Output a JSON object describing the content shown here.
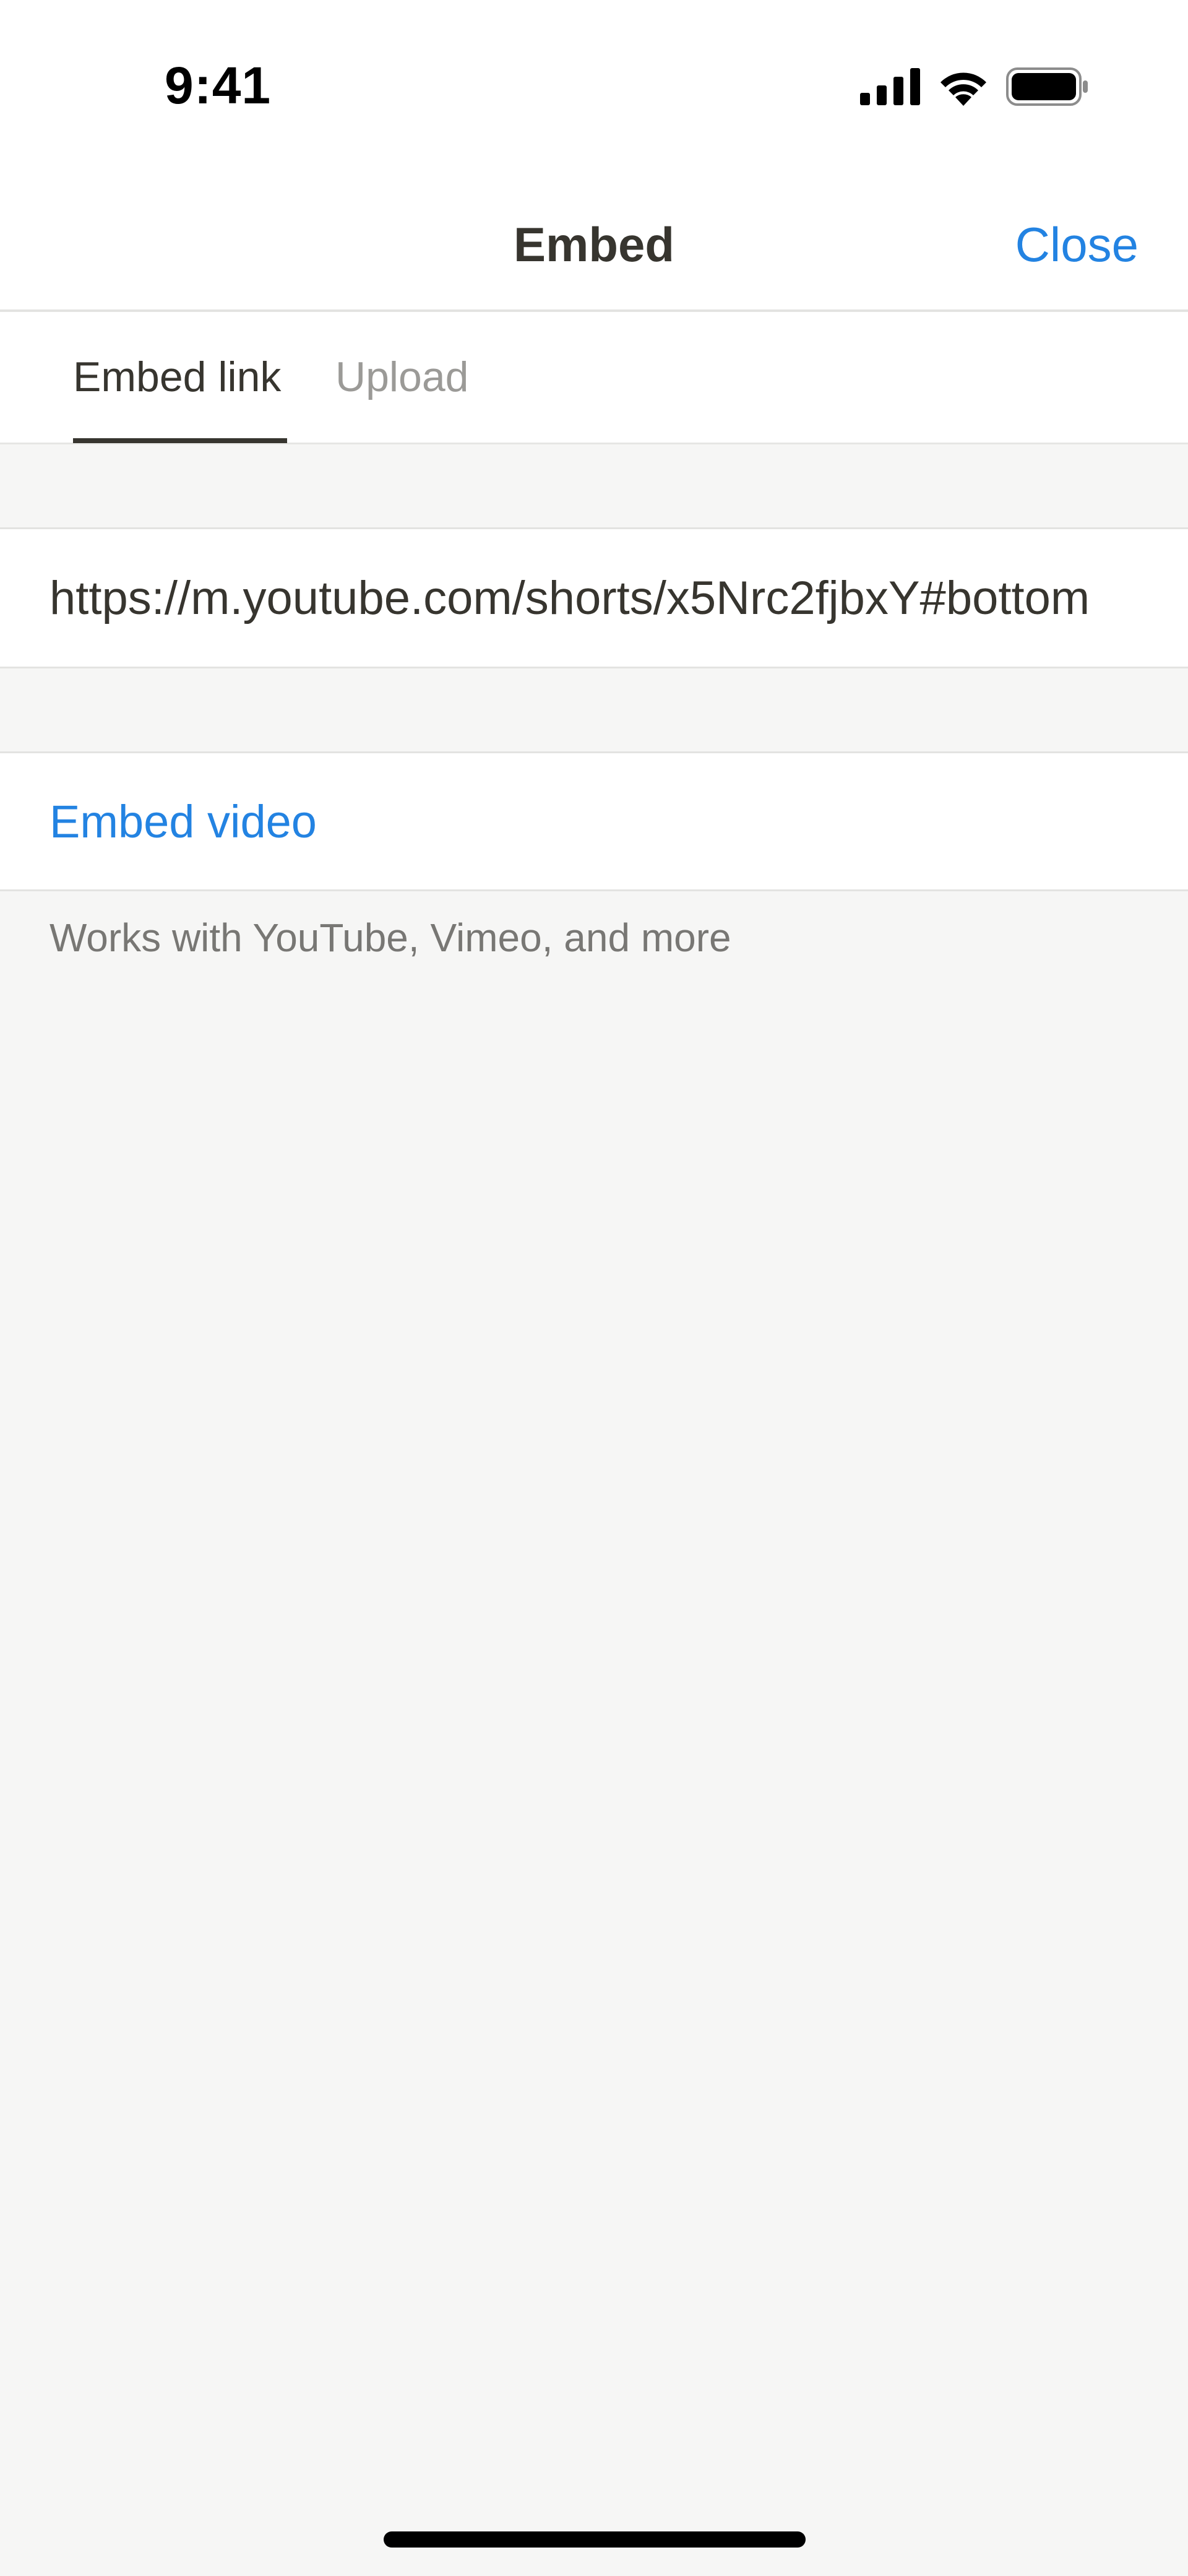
{
  "status_bar": {
    "time": "9:41",
    "icons": [
      "cellular-signal-icon",
      "wifi-icon",
      "battery-icon"
    ]
  },
  "nav": {
    "title": "Embed",
    "close_label": "Close"
  },
  "tabs": [
    {
      "label": "Embed link",
      "active": true
    },
    {
      "label": "Upload",
      "active": false
    }
  ],
  "url_field": {
    "value": "https://m.youtube.com/shorts/x5Nrc2fjbxY#bottom"
  },
  "embed_button": {
    "label": "Embed video"
  },
  "helper": {
    "text": "Works with YouTube, Vimeo, and more"
  },
  "colors": {
    "accent": "#2383e2",
    "text_primary": "#37352f",
    "text_secondary": "#787774",
    "background": "#f6f6f5"
  }
}
